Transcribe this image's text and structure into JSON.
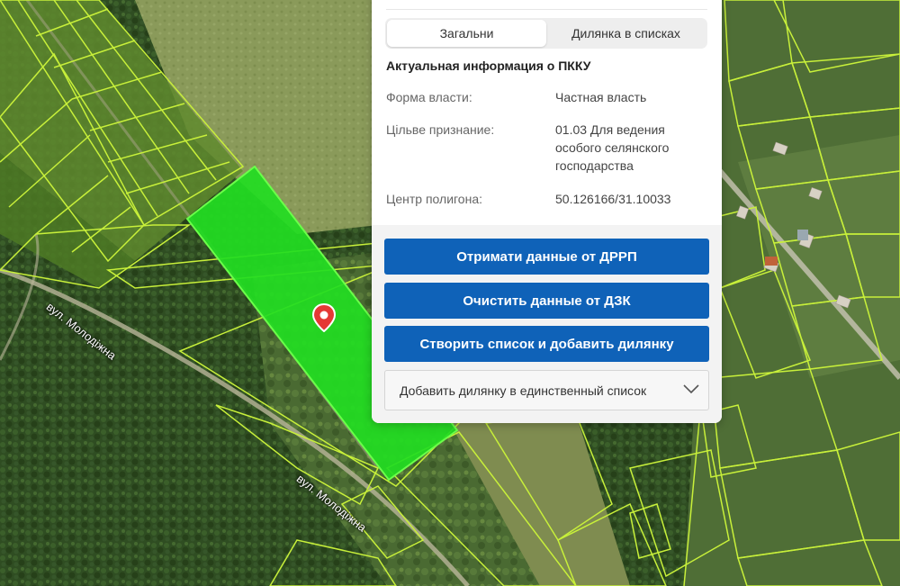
{
  "map": {
    "streets": [
      {
        "name": "вул. Молодіжна"
      },
      {
        "name": "вул. Молодіжна"
      }
    ],
    "colors": {
      "parcel_outline": "#c8f03a",
      "selected_parcel": "#22dd22",
      "pin": "#e53935"
    }
  },
  "panel": {
    "tabs": [
      {
        "label": "Загальни",
        "active": true
      },
      {
        "label": "Дилянка в списках",
        "active": false
      }
    ],
    "section_title": "Актуальная информация о ПККУ",
    "rows": {
      "form": {
        "label": "Форма власти:",
        "value": "Частная власть"
      },
      "purpose": {
        "label": "Цільве признание:",
        "value": "01.03 Для ведения особого селянского господарства"
      },
      "center": {
        "label": "Центр полигона:",
        "value": "50.126166/31.10033"
      }
    },
    "buttons": {
      "drrp": "Отримати данные от ДРРП",
      "clear": "Очистить данные от ДЗК",
      "create": "Створить список и добавить дилянку"
    },
    "select": {
      "label": "Добавить дилянку в единственный список"
    },
    "colors": {
      "button": "#0f62b8"
    }
  }
}
